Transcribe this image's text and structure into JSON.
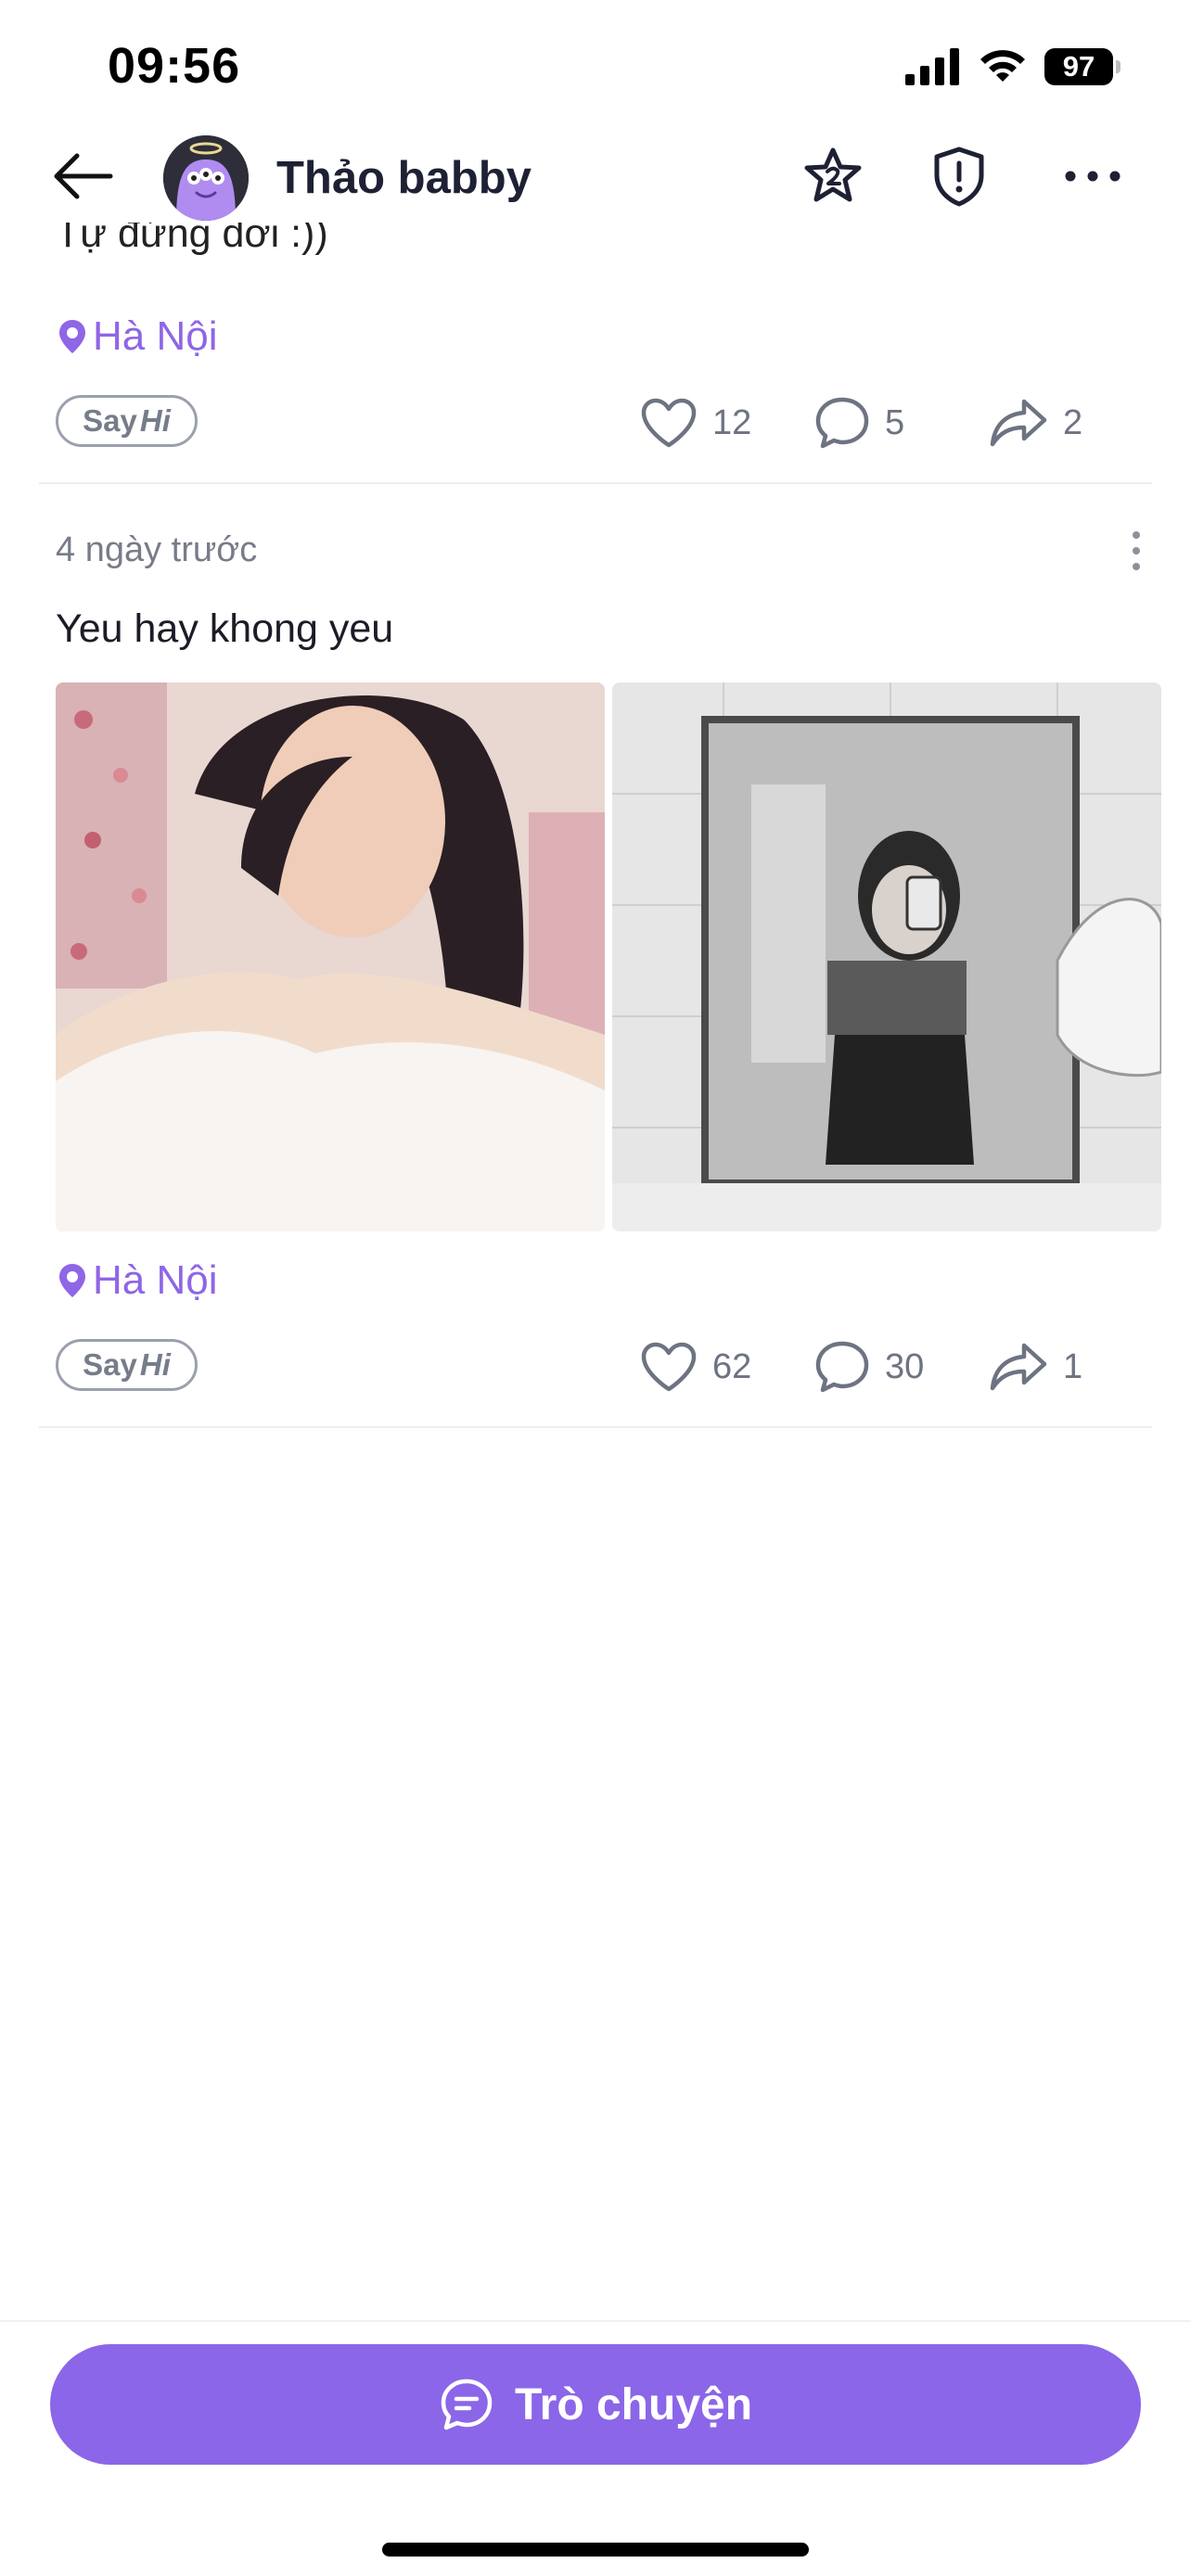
{
  "status_bar": {
    "time": "09:56",
    "battery": "97"
  },
  "header": {
    "name": "Thảo babby"
  },
  "posts": [
    {
      "text_clipped": "Tự đứng dơi :))",
      "location": "Hà Nội",
      "sayhi": {
        "say": "Say",
        "hi": "Hi"
      },
      "likes": "12",
      "comments": "5",
      "shares": "2"
    },
    {
      "time": "4 ngày trước",
      "text": "Yeu hay khong yeu",
      "location": "Hà Nội",
      "sayhi": {
        "say": "Say",
        "hi": "Hi"
      },
      "likes": "62",
      "comments": "30",
      "shares": "1"
    }
  ],
  "bottom": {
    "chat_label": "Trò chuyện"
  },
  "colors": {
    "accent": "#8b66e8",
    "location": "#8f66e6",
    "muted": "#6e7382"
  }
}
